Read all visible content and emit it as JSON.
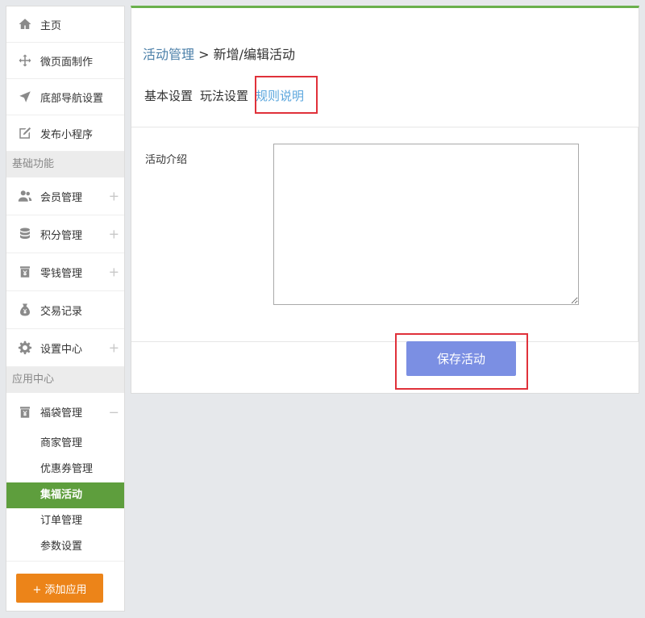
{
  "sidebar": {
    "top_items": [
      {
        "label": "主页",
        "icon": "home-icon"
      },
      {
        "label": "微页面制作",
        "icon": "move-arrows-icon"
      },
      {
        "label": "底部导航设置",
        "icon": "navigation-arrow-icon"
      },
      {
        "label": "发布小程序",
        "icon": "edit-square-icon"
      }
    ],
    "section_basic": "基础功能",
    "basic_items": [
      {
        "label": "会员管理",
        "icon": "users-icon",
        "expander": "+"
      },
      {
        "label": "积分管理",
        "icon": "database-icon",
        "expander": "+"
      },
      {
        "label": "零钱管理",
        "icon": "yen-jar-icon",
        "expander": "+"
      },
      {
        "label": "交易记录",
        "icon": "money-bag-icon"
      },
      {
        "label": "设置中心",
        "icon": "gear-icon",
        "expander": "+"
      }
    ],
    "section_apps": "应用中心",
    "app_group": {
      "label": "福袋管理",
      "icon": "yen-jar-icon",
      "expander": "−"
    },
    "app_sub_items": [
      {
        "label": "商家管理",
        "active": false
      },
      {
        "label": "优惠券管理",
        "active": false
      },
      {
        "label": "集福活动",
        "active": true
      },
      {
        "label": "订单管理",
        "active": false
      },
      {
        "label": "参数设置",
        "active": false
      }
    ],
    "add_app_label": "+ 添加应用"
  },
  "main": {
    "breadcrumb": {
      "link": "活动管理",
      "separator": " > ",
      "current": "新增/编辑活动"
    },
    "tabs": [
      {
        "label": "基本设置",
        "active": false
      },
      {
        "label": "玩法设置",
        "active": false
      },
      {
        "label": "规则说明",
        "active": true
      }
    ],
    "form": {
      "intro_label": "活动介绍",
      "intro_value": ""
    },
    "save_label": "保存活动"
  },
  "colors": {
    "accent_green": "#6ab04c",
    "active_item_bg": "#5e9e3d",
    "add_button": "#ec8419",
    "save_button": "#7b8fe3",
    "active_tab": "#5aa6dd",
    "highlight": "#e0313a"
  }
}
